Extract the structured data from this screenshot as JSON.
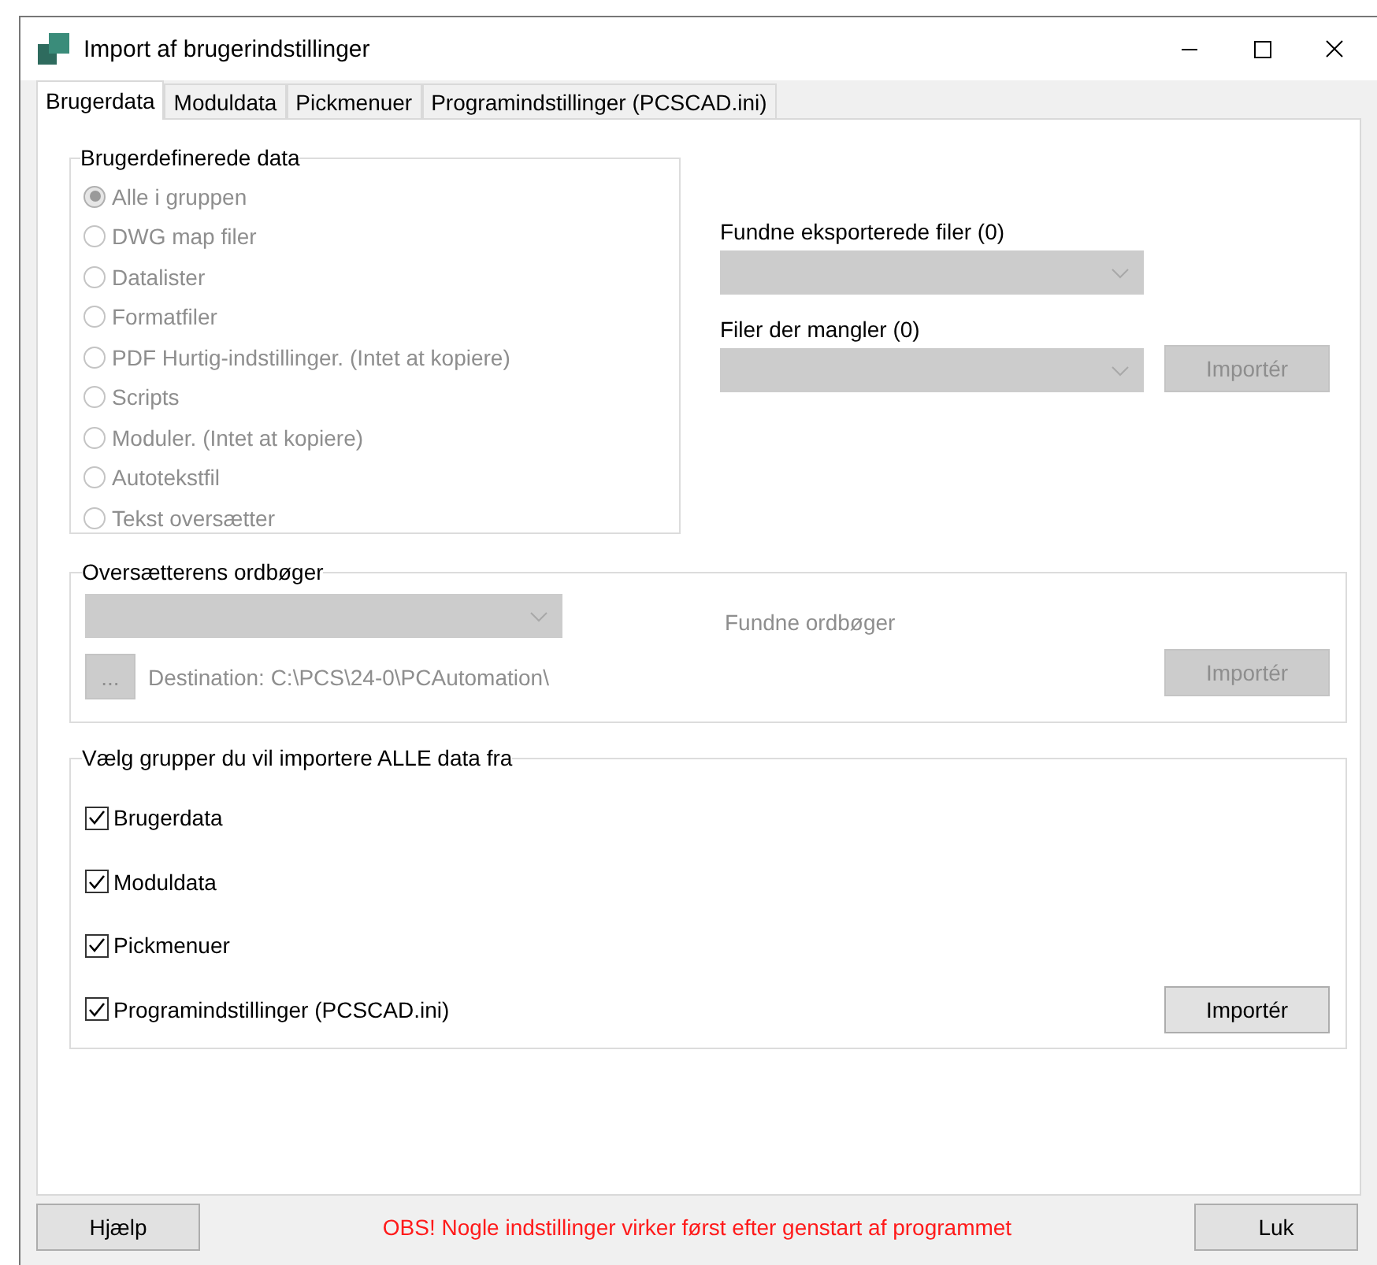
{
  "window": {
    "title": "Import af brugerindstillinger"
  },
  "tabs": [
    {
      "label": "Brugerdata",
      "selected": true
    },
    {
      "label": "Moduldata",
      "selected": false
    },
    {
      "label": "Pickmenuer",
      "selected": false
    },
    {
      "label": "Programindstillinger (PCSCAD.ini)",
      "selected": false
    }
  ],
  "user_data": {
    "legend": "Brugerdefinerede data",
    "disabled": true,
    "options": [
      {
        "label": "Alle i gruppen",
        "selected": true
      },
      {
        "label": "DWG map filer",
        "selected": false
      },
      {
        "label": "Datalister",
        "selected": false
      },
      {
        "label": "Formatfiler",
        "selected": false
      },
      {
        "label": "PDF Hurtig-indstillinger. (Intet at kopiere)",
        "selected": false
      },
      {
        "label": "Scripts",
        "selected": false
      },
      {
        "label": "Moduler. (Intet at kopiere)",
        "selected": false
      },
      {
        "label": "Autotekstfil",
        "selected": false
      },
      {
        "label": "Tekst oversætter",
        "selected": false
      }
    ]
  },
  "exported_files": {
    "label": "Fundne eksporterede filer (0)",
    "disabled": true
  },
  "missing_files": {
    "label": "Filer der mangler (0)",
    "disabled": true,
    "import_button": {
      "label": "Importér",
      "disabled": true
    }
  },
  "dictionaries": {
    "legend": "Oversætterens ordbøger",
    "dropdown_disabled": true,
    "found_label": "Fundne ordbøger",
    "browse_button": {
      "label": "...",
      "disabled": true
    },
    "destination": "Destination: C:\\PCS\\24-0\\PCAutomation\\",
    "import_button": {
      "label": "Importér",
      "disabled": true
    }
  },
  "groups": {
    "legend": "Vælg grupper du vil importere ALLE data fra",
    "items": [
      {
        "label": "Brugerdata",
        "checked": true
      },
      {
        "label": "Moduldata",
        "checked": true
      },
      {
        "label": "Pickmenuer",
        "checked": true
      },
      {
        "label": "Programindstillinger (PCSCAD.ini)",
        "checked": true
      }
    ],
    "import_button": {
      "label": "Importér",
      "disabled": false
    }
  },
  "footer": {
    "help_button": "Hjælp",
    "notice": "OBS! Nogle indstillinger virker først efter genstart af programmet",
    "close_button": "Luk"
  }
}
